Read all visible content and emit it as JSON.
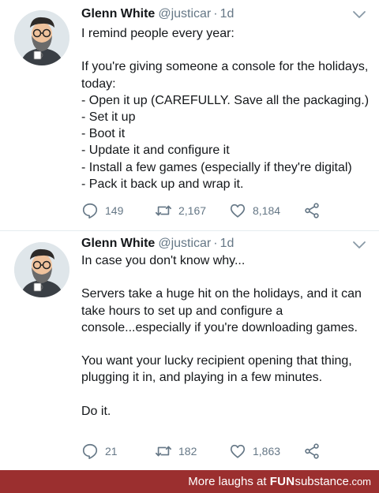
{
  "tweets": [
    {
      "name": "Glenn White",
      "handle": "@justicar",
      "separator": "·",
      "time": "1d",
      "lines": [
        "I remind people every year:",
        "",
        "If you're giving someone a console for the holidays,",
        "today:",
        "- Open it up (CAREFULLY. Save all the packaging.)",
        "- Set it up",
        "- Boot it",
        "- Update it and configure it",
        "- Install a few games (especially if they're digital)",
        "- Pack it back up and wrap it."
      ],
      "replies": "149",
      "retweets": "2,167",
      "likes": "8,184"
    },
    {
      "name": "Glenn White",
      "handle": "@justicar",
      "separator": "·",
      "time": "1d",
      "lines": [
        "In case you don't know why...",
        "",
        "Servers take a huge hit on the holidays, and it can",
        "take hours to set up and configure a",
        "console...especially if you're downloading games.",
        "",
        "You want your lucky recipient opening that thing,",
        "plugging it in, and playing in a few minutes.",
        "",
        "Do it."
      ],
      "replies": "21",
      "retweets": "182",
      "likes": "1,863"
    }
  ],
  "footer": {
    "prefix": "More laughs at",
    "brand_fun": "FUN",
    "brand_substance": "substance",
    "brand_tld": ".com"
  },
  "colors": {
    "text": "#14171a",
    "muted": "#657786",
    "footer_bg": "#9b2f2f"
  },
  "icons": [
    "chevron-down-icon",
    "reply-icon",
    "retweet-icon",
    "like-icon",
    "share-icon"
  ]
}
